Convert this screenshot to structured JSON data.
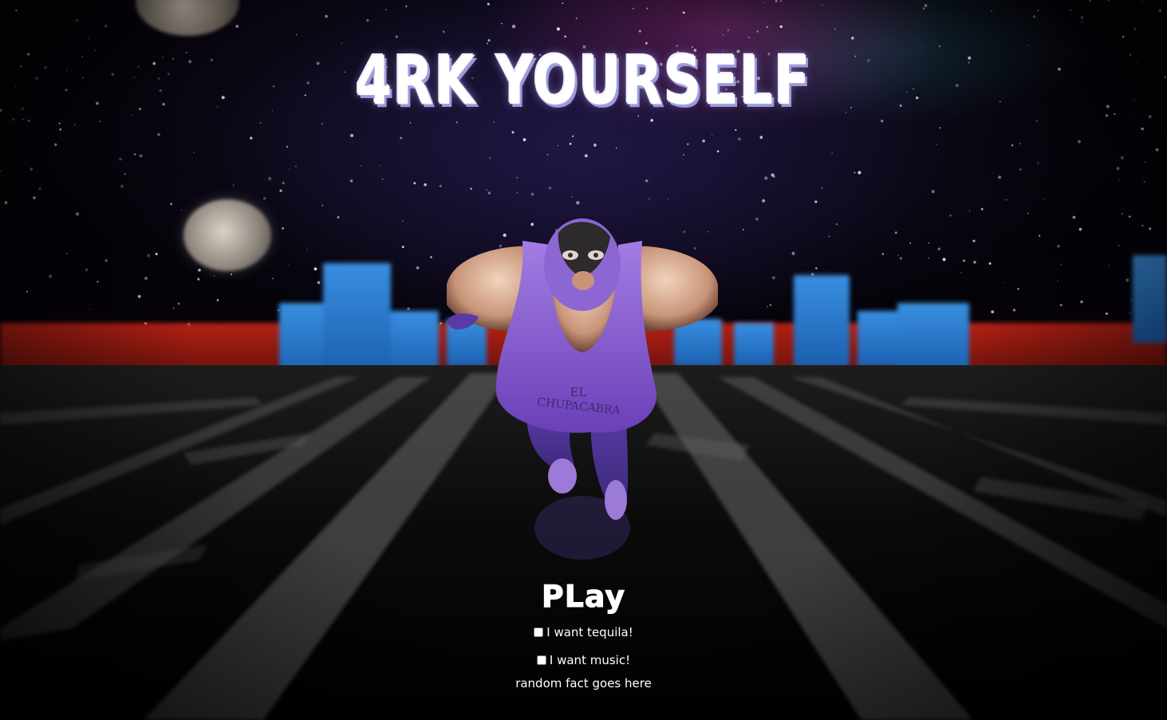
{
  "game": {
    "title": "4RK YOURSELF",
    "character_shirt_text": [
      "EL",
      "CHUPACABRA"
    ]
  },
  "menu": {
    "play_label": "PLay",
    "options": [
      {
        "label": "I want tequila!",
        "checked": false
      },
      {
        "label": "I want music!",
        "checked": false
      }
    ],
    "random_fact": "random fact goes here"
  },
  "colors": {
    "costume": "#8a5fd0",
    "arena_wall": "#b62014",
    "banner": "#3a8fe0"
  }
}
